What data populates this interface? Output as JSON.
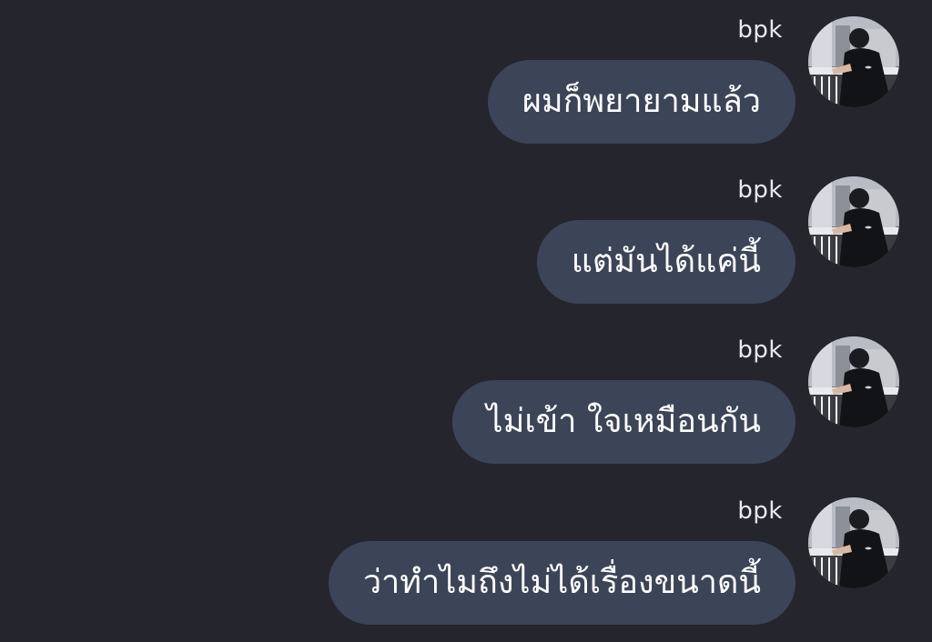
{
  "chat": {
    "messages": [
      {
        "sender": "bpk",
        "text": "ผมก็พยายามแล้ว"
      },
      {
        "sender": "bpk",
        "text": "แต่มันได้แค่นี้"
      },
      {
        "sender": "bpk",
        "text": "ไม่เข้า ใจเหมือนกัน"
      },
      {
        "sender": "bpk",
        "text": "ว่าทำไมถึงไม่ได้เรื่องขนาดนี้"
      }
    ]
  },
  "colors": {
    "background": "#25252e",
    "bubble": "#3c4458",
    "text": "#ffffff"
  },
  "icons": {
    "avatar": "profile-photo"
  }
}
